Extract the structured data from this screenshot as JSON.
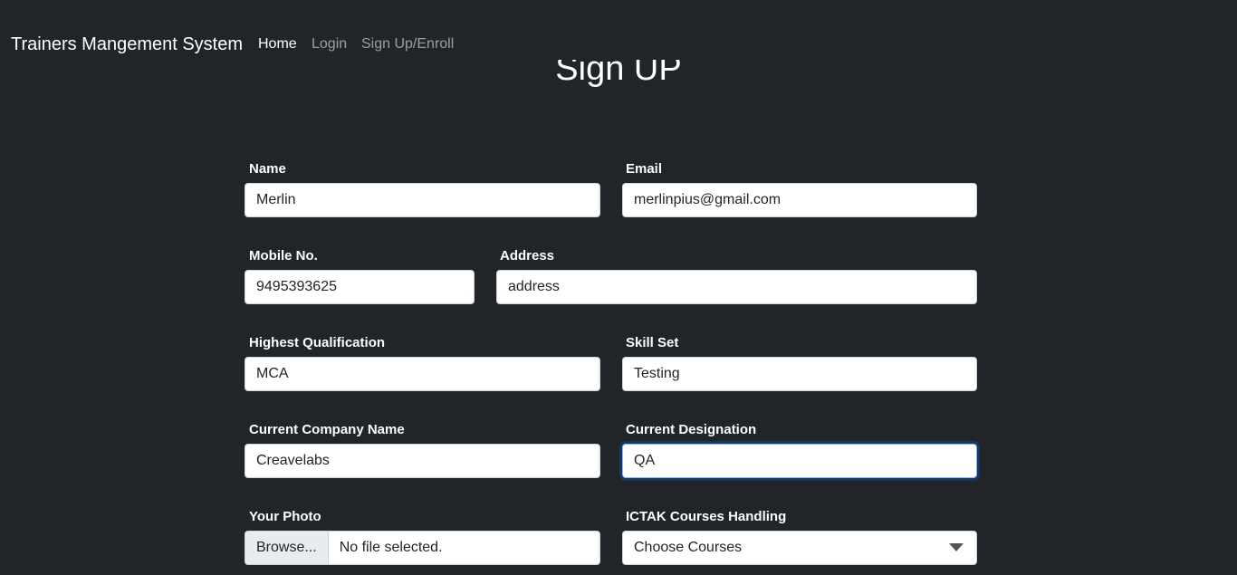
{
  "page": {
    "title": "Sign UP"
  },
  "navbar": {
    "brand": "Trainers Mangement System",
    "links": [
      {
        "label": "Home",
        "active": true
      },
      {
        "label": "Login",
        "active": false
      },
      {
        "label": "Sign Up/Enroll",
        "active": false
      }
    ]
  },
  "form": {
    "name": {
      "label": "Name",
      "value": "Merlin"
    },
    "email": {
      "label": "Email",
      "value": "merlinpius@gmail.com"
    },
    "mobile": {
      "label": "Mobile No.",
      "value": "9495393625"
    },
    "address": {
      "label": "Address",
      "value": "address"
    },
    "qualification": {
      "label": "Highest Qualification",
      "value": "MCA"
    },
    "skills": {
      "label": "Skill Set",
      "value": "Testing"
    },
    "company": {
      "label": "Current Company Name",
      "value": "Creavelabs"
    },
    "designation": {
      "label": "Current Designation",
      "value": "QA"
    },
    "photo": {
      "label": "Your Photo",
      "button": "Browse...",
      "status": "No file selected."
    },
    "courses": {
      "label": "ICTAK Courses Handling",
      "selected": "Choose Courses"
    }
  },
  "colors": {
    "background": "#212529",
    "focus_ring": "#86b7fe"
  }
}
